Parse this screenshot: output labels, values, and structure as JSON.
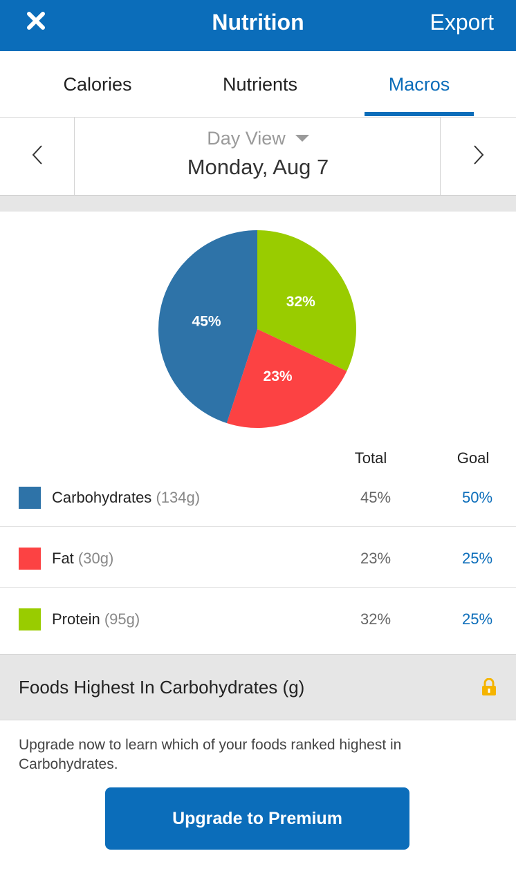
{
  "header": {
    "title": "Nutrition",
    "export_label": "Export",
    "close_icon": "close-icon"
  },
  "tabs": [
    {
      "label": "Calories",
      "active": false
    },
    {
      "label": "Nutrients",
      "active": false
    },
    {
      "label": "Macros",
      "active": true
    }
  ],
  "date_nav": {
    "view_label": "Day View",
    "date": "Monday, Aug 7"
  },
  "colors": {
    "brand": "#0b6dba",
    "carbohydrates": "#2e73a8",
    "fat": "#fc4243",
    "protein": "#99cc00"
  },
  "chart_data": {
    "type": "pie",
    "categories": [
      "Protein",
      "Fat",
      "Carbohydrates"
    ],
    "values": [
      32,
      23,
      45
    ],
    "labels": [
      "32%",
      "23%",
      "45%"
    ],
    "colors": [
      "#99cc00",
      "#fc4243",
      "#2e73a8"
    ]
  },
  "table": {
    "total_header": "Total",
    "goal_header": "Goal",
    "rows": [
      {
        "name": "Carbohydrates",
        "grams": "(134g)",
        "total": "45%",
        "goal": "50%",
        "color": "#2e73a8"
      },
      {
        "name": "Fat",
        "grams": "(30g)",
        "total": "23%",
        "goal": "25%",
        "color": "#fc4243"
      },
      {
        "name": "Protein",
        "grams": "(95g)",
        "total": "32%",
        "goal": "25%",
        "color": "#99cc00"
      }
    ]
  },
  "foods": {
    "title": "Foods Highest In Carbohydrates (g)",
    "upgrade_text": "Upgrade now to learn which of your foods ranked highest in Carbohydrates.",
    "upgrade_button": "Upgrade to Premium",
    "lock_icon": "lock-icon"
  }
}
